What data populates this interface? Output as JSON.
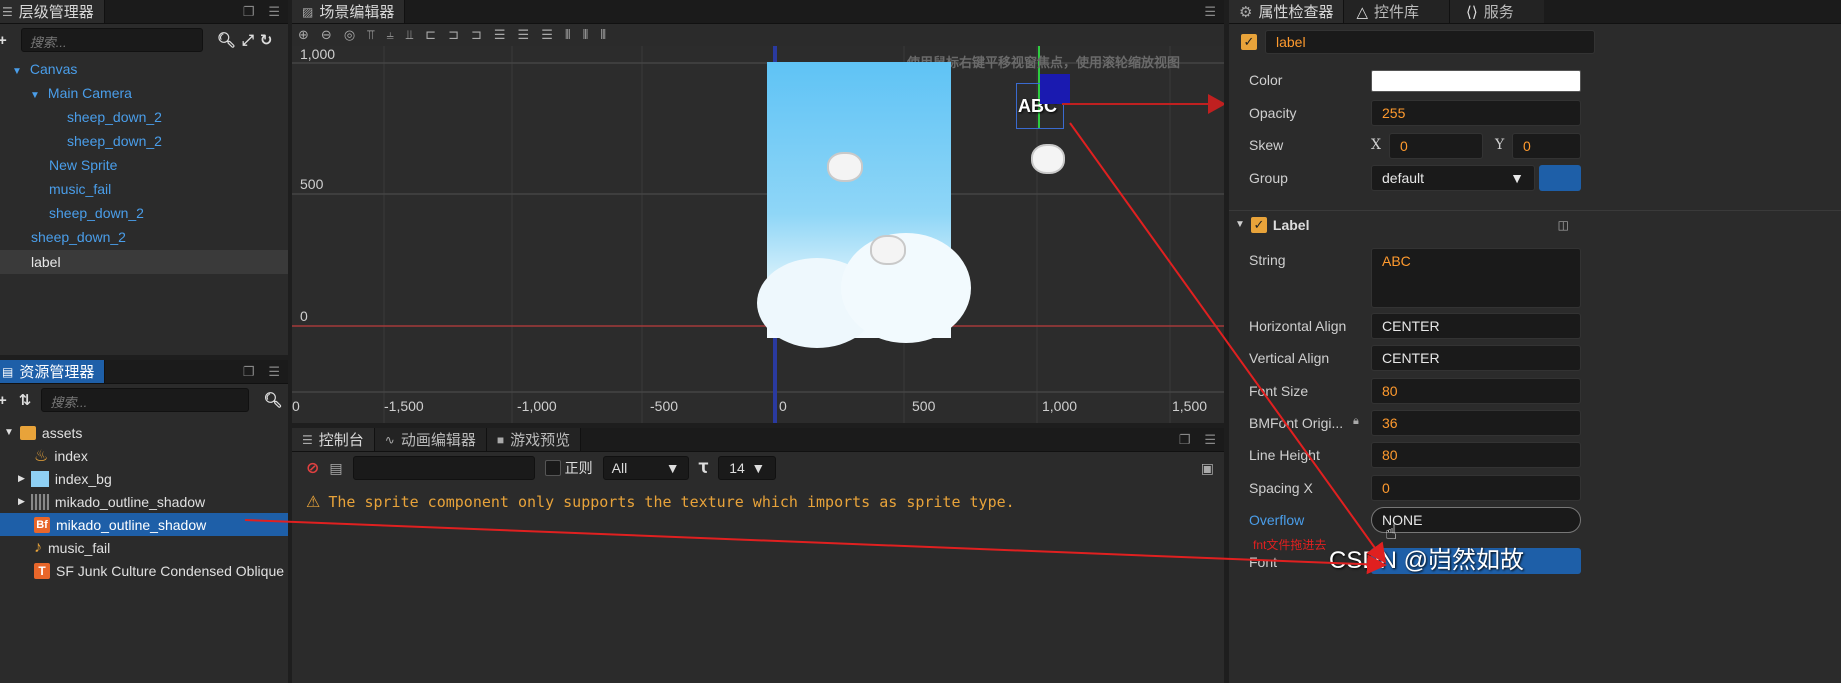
{
  "hierarchy": {
    "title": "层级管理器",
    "search_placeholder": "搜索...",
    "nodes": [
      {
        "label": "Canvas",
        "arrow": "▼"
      },
      {
        "label": "Main Camera",
        "arrow": "▼"
      },
      {
        "label": "sheep_down_2"
      },
      {
        "label": "sheep_down_2"
      },
      {
        "label": "New Sprite"
      },
      {
        "label": "music_fail"
      },
      {
        "label": "sheep_down_2"
      },
      {
        "label": "sheep_down_2"
      },
      {
        "label": "label"
      }
    ]
  },
  "assets": {
    "title": "资源管理器",
    "search_placeholder": "搜索...",
    "items": [
      {
        "label": "assets",
        "icon": "folder-icon"
      },
      {
        "label": "index",
        "icon": "fire-icon"
      },
      {
        "label": "index_bg",
        "icon": "image-icon"
      },
      {
        "label": "mikado_outline_shadow",
        "icon": "texture-icon"
      },
      {
        "label": "mikado_outline_shadow",
        "icon": "bmfont-icon",
        "icon_text": "Bf"
      },
      {
        "label": "music_fail",
        "icon": "music-icon"
      },
      {
        "label": "SF Junk Culture Condensed Oblique",
        "icon": "font-icon",
        "icon_text": "T"
      }
    ]
  },
  "scene": {
    "title": "场景编辑器",
    "hint": "使用鼠标右键平移视窗焦点，使用滚轮缩放视图",
    "y_labels": [
      "1,000",
      "500",
      "0"
    ],
    "x_labels": [
      "0",
      "-1,500",
      "-1,000",
      "-500",
      "0",
      "500",
      "1,000",
      "1,500"
    ],
    "label_text": "ABC"
  },
  "console": {
    "tabs": [
      "控制台",
      "动画编辑器",
      "游戏预览"
    ],
    "regex_label": "正则",
    "filter_value": "All",
    "font_size_value": "14",
    "message": "The sprite component only supports the texture which imports as sprite type."
  },
  "inspector": {
    "tabs": [
      "属性检查器",
      "控件库",
      "服务"
    ],
    "node_name": "label",
    "node_props": [
      {
        "label": "Color"
      },
      {
        "label": "Opacity",
        "value": "255"
      },
      {
        "label": "Skew",
        "x_label": "X",
        "x_value": "0",
        "y_label": "Y",
        "y_value": "0"
      },
      {
        "label": "Group",
        "value": "default"
      }
    ],
    "component_title": "Label",
    "label_props": [
      {
        "label": "String",
        "value": "ABC"
      },
      {
        "label": "Horizontal Align",
        "value": "CENTER"
      },
      {
        "label": "Vertical Align",
        "value": "CENTER"
      },
      {
        "label": "Font Size",
        "value": "80"
      },
      {
        "label": "BMFont Origi...",
        "value": "36"
      },
      {
        "label": "Line Height",
        "value": "80"
      },
      {
        "label": "Spacing X",
        "value": "0"
      },
      {
        "label": "Overflow",
        "value": "NONE"
      },
      {
        "label": "Font",
        "value": ""
      }
    ]
  },
  "annotation": {
    "drag_note": "fnt文件拖进去"
  },
  "watermark": "CSDN @岿然如故",
  "colors": {
    "accent_blue": "#1e5fa8",
    "tree_blue": "#4a9eea",
    "value_orange": "#ff9a2e",
    "arrow_red": "#e02020"
  }
}
